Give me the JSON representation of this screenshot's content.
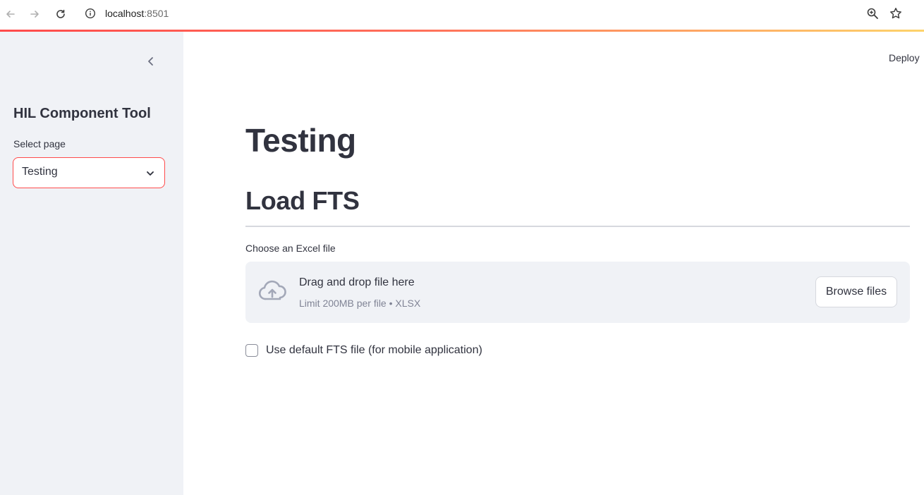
{
  "browser": {
    "url_host": "localhost",
    "url_port": ":8501",
    "icons": [
      "back-arrow-icon",
      "forward-arrow-icon",
      "reload-icon",
      "info-icon",
      "zoom-icon",
      "star-icon"
    ]
  },
  "sidebar": {
    "title": "HIL Component Tool",
    "select_label": "Select page",
    "selected_page": "Testing"
  },
  "header": {
    "deploy_label": "Deploy"
  },
  "main": {
    "page_title": "Testing",
    "section_title": "Load FTS",
    "file_label": "Choose an Excel file",
    "dropzone": {
      "main_text": "Drag and drop file here",
      "sub_text": "Limit 200MB per file • XLSX",
      "browse_label": "Browse files"
    },
    "checkbox_label": "Use default FTS file (for mobile application)",
    "checkbox_checked": false
  },
  "colors": {
    "accent": "#ff4b4b",
    "sidebar_bg": "#f0f2f6",
    "text": "#31333f",
    "muted_text": "#808495"
  }
}
